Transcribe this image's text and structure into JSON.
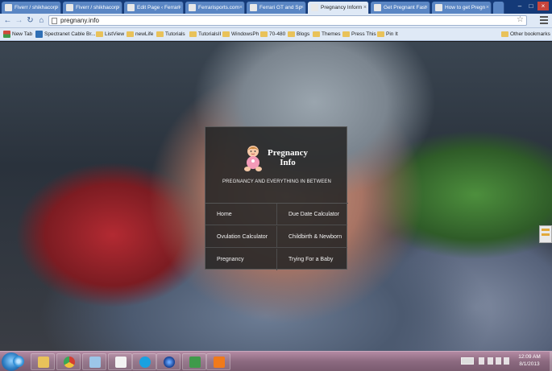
{
  "browser": {
    "tabs": [
      {
        "label": "Fiverr / shikhacorp",
        "active": false
      },
      {
        "label": "Fiverr / shikhacorp",
        "active": false
      },
      {
        "label": "Edit Page ‹ Ferrari",
        "active": false
      },
      {
        "label": "Ferrarisports.com",
        "active": false
      },
      {
        "label": "Ferrari GT and Sp",
        "active": false
      },
      {
        "label": "Pregnancy Inform",
        "active": true
      },
      {
        "label": "Get Pregnant Fast",
        "active": false
      },
      {
        "label": "How to get Pregn",
        "active": false
      }
    ],
    "address": "pregnany.info",
    "bookmarks": [
      {
        "label": "New Tab",
        "icon": "app-icon"
      },
      {
        "label": "Spectranet Cable Br...",
        "icon": "app-icon"
      },
      {
        "label": "ListView",
        "icon": "folder-icon"
      },
      {
        "label": "newLife",
        "icon": "folder-icon"
      },
      {
        "label": "Tutorials",
        "icon": "folder-icon"
      },
      {
        "label": "TutorialsII",
        "icon": "folder-icon"
      },
      {
        "label": "WindowsPh",
        "icon": "folder-icon"
      },
      {
        "label": "70-480",
        "icon": "folder-icon"
      },
      {
        "label": "Blogs",
        "icon": "folder-icon"
      },
      {
        "label": "Themes",
        "icon": "folder-icon"
      },
      {
        "label": "Press This",
        "icon": "folder-icon"
      },
      {
        "label": "Pin It",
        "icon": "folder-icon"
      }
    ],
    "other_bookmarks": "Other bookmarks"
  },
  "site": {
    "brand_line1": "Pregnancy",
    "brand_line2": "Info",
    "tagline": "PREGNANCY AND EVERYTHING IN BETWEEN",
    "menu": [
      "Home",
      "Due Date Calculator",
      "Ovulation Calculator",
      "Childbirth & Newborn",
      "Pregnancy",
      "Trying For a Baby"
    ]
  },
  "taskbar": {
    "clock_time": "12:09 AM",
    "clock_date": "8/1/2013",
    "icons": [
      "internet-explorer-icon",
      "file-explorer-icon",
      "chrome-icon",
      "app-icon",
      "notepad-icon",
      "skype-icon",
      "media-icon",
      "book-icon",
      "xampp-icon"
    ],
    "colors": {
      "ie": "#2f8fd8",
      "explorer": "#e8c25a",
      "chrome": "#d23f31",
      "skype": "#1aa1e0",
      "xampp": "#f07a1b"
    }
  }
}
